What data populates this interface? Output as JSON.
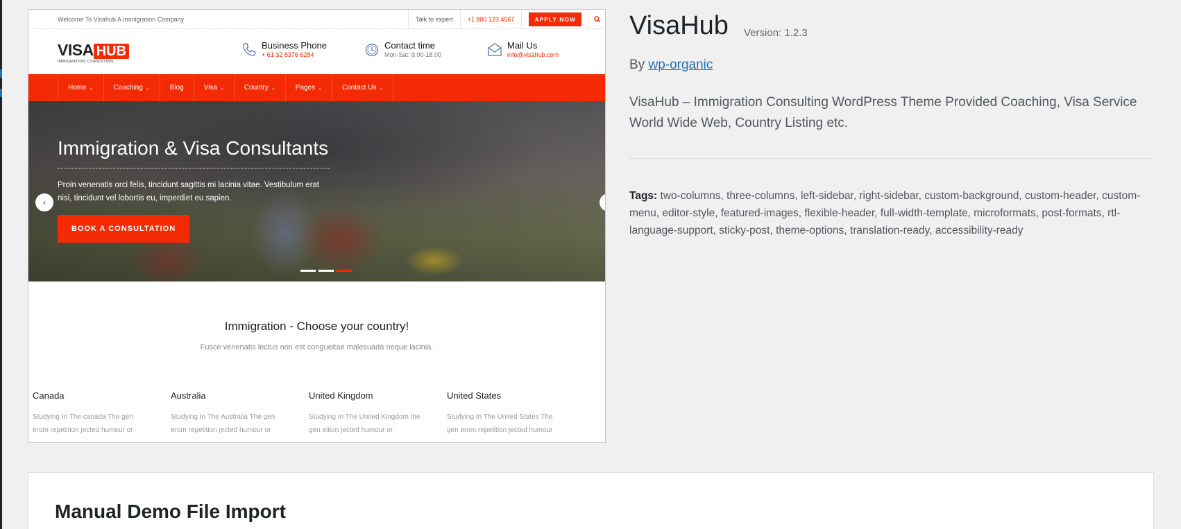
{
  "theme_shot": {
    "topbar": {
      "welcome": "Welcome To Visahub A Immigration Company",
      "talk": "Talk to expert",
      "phone": "+1 800 123 4567",
      "apply": "APPLY NOW",
      "search_icon": "search-icon"
    },
    "logo": {
      "visa": "VISA",
      "hub": "HUB",
      "sub": "IMMIGRATION CONSULTING"
    },
    "header_items": [
      {
        "icon": "phone-icon",
        "title": "Business Phone",
        "value": "+ 61 32 8376 6284"
      },
      {
        "icon": "clock-icon",
        "title": "Contact time",
        "value": "Mon-Sat: 9.00-18.00"
      },
      {
        "icon": "mail-icon",
        "title": "Mail Us",
        "value": "info@visahub.com"
      }
    ],
    "nav": [
      {
        "label": "Home",
        "has_dropdown": true
      },
      {
        "label": "Coaching",
        "has_dropdown": true
      },
      {
        "label": "Blog",
        "has_dropdown": false
      },
      {
        "label": "Visa",
        "has_dropdown": true
      },
      {
        "label": "Country",
        "has_dropdown": true
      },
      {
        "label": "Pages",
        "has_dropdown": true
      },
      {
        "label": "Contact Us",
        "has_dropdown": true
      }
    ],
    "hero": {
      "title": "Immigration & Visa Consultants",
      "text": "Proin venenatis orci felis, tincidunt sagittis mi lacinia vitae. Vestibulum erat nisi, tincidunt vel lobortis eu, imperdiet eu sapien.",
      "cta": "BOOK A CONSULTATION",
      "prev": "‹",
      "next": "›",
      "slides_total": 3,
      "slide_active": 3
    },
    "choose": {
      "heading": "Immigration - Choose your country!",
      "sub": "Fusce venenatis lectus non est congueitae malesuada neque lacinia."
    },
    "countries": [
      {
        "name": "Canada",
        "desc": "Studying In The canada The gen erom repetition jected humour or"
      },
      {
        "name": "Australia",
        "desc": "Studying In The Australia The gen erom repetition jected humour or"
      },
      {
        "name": "United Kingdom",
        "desc": "Studying In The United Kingdom the gen eition jected humour or"
      },
      {
        "name": "United States",
        "desc": "Studying In The United States The gen erom repetition jected humour"
      }
    ]
  },
  "theme_info": {
    "name": "VisaHub",
    "version": "Version: 1.2.3",
    "by_prefix": "By",
    "author": "wp-organic",
    "description": "VisaHub – Immigration Consulting WordPress Theme Provided Coaching, Visa Service World Wide Web, Country Listing etc.",
    "tags_label": "Tags:",
    "tags": "two-columns, three-columns, left-sidebar, right-sidebar, custom-background, custom-header, custom-menu, editor-style, featured-images, flexible-header, full-width-template, microformats, post-formats, rtl-language-support, sticky-post, theme-options, translation-ready, accessibility-ready"
  },
  "demo_import": {
    "title": "Manual Demo File Import"
  },
  "colors": {
    "brand_red": "#f42a04",
    "link_blue": "#2271b1",
    "admin_bg": "#f0f0f1"
  }
}
